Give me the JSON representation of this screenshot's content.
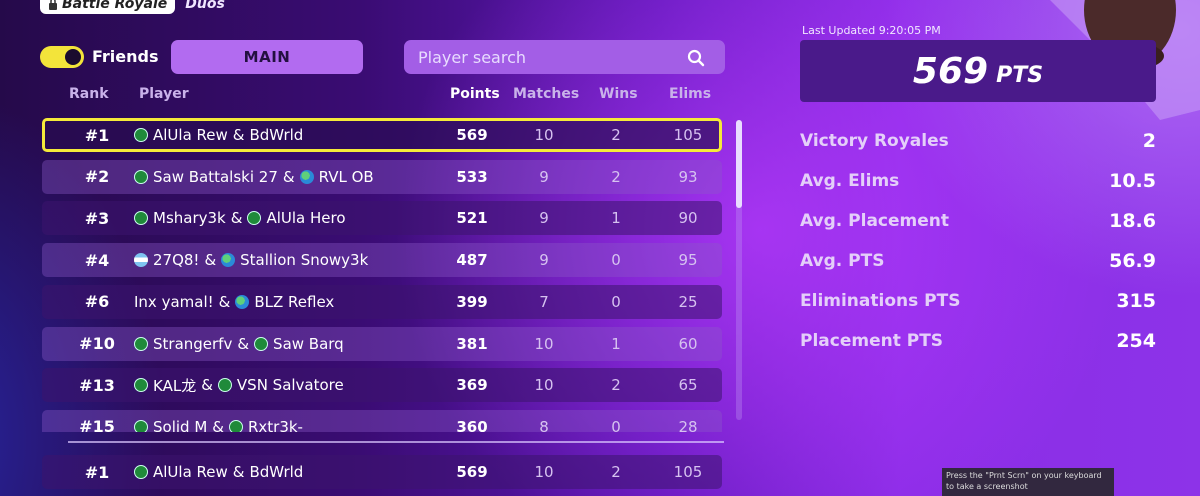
{
  "header": {
    "mode_label": "Battle Royale",
    "sub_mode": "Duos"
  },
  "controls": {
    "friends_label": "Friends",
    "friends_toggle_on": true,
    "main_label": "MAIN",
    "search_placeholder": "Player search"
  },
  "columns": {
    "rank": "Rank",
    "player": "Player",
    "points": "Points",
    "matches": "Matches",
    "wins": "Wins",
    "elims": "Elims"
  },
  "rows": [
    {
      "rank": "#1",
      "p1": "AlUla Rew",
      "sep": "&",
      "p2": "BdWrld",
      "points": "569",
      "matches": "10",
      "wins": "2",
      "elims": "105",
      "f1": "sa",
      "f2": "",
      "selected": true
    },
    {
      "rank": "#2",
      "p1": "Saw Battalski 27",
      "sep": "&",
      "p2": "RVL OB",
      "points": "533",
      "matches": "9",
      "wins": "2",
      "elims": "93",
      "f1": "sa",
      "f2": "globe"
    },
    {
      "rank": "#3",
      "p1": "Mshary3k",
      "sep": "&",
      "p2": "AlUla Hero",
      "points": "521",
      "matches": "9",
      "wins": "1",
      "elims": "90",
      "f1": "sa",
      "f2": "sa"
    },
    {
      "rank": "#4",
      "p1": "27Q8!",
      "sep": "&",
      "p2": "Stallion Snowy3k",
      "points": "487",
      "matches": "9",
      "wins": "0",
      "elims": "95",
      "f1": "ar",
      "f2": "globe"
    },
    {
      "rank": "#6",
      "p1": "Inx yamal!",
      "sep": "&",
      "p2": "BLZ Reflex",
      "points": "399",
      "matches": "7",
      "wins": "0",
      "elims": "25",
      "f1": "",
      "f2": "globe"
    },
    {
      "rank": "#10",
      "p1": "Strangerfv",
      "sep": "&",
      "p2": "Saw Barq",
      "points": "381",
      "matches": "10",
      "wins": "1",
      "elims": "60",
      "f1": "sa",
      "f2": "sa"
    },
    {
      "rank": "#13",
      "p1": "KAL龙",
      "sep": "&",
      "p2": "VSN Salvatore",
      "points": "369",
      "matches": "10",
      "wins": "2",
      "elims": "65",
      "f1": "sa",
      "f2": "sa"
    },
    {
      "rank": "#15",
      "p1": "Solid M",
      "sep": "&",
      "p2": "Rxtr3k-",
      "points": "360",
      "matches": "8",
      "wins": "0",
      "elims": "28",
      "f1": "sa",
      "f2": "sa"
    }
  ],
  "my_row": {
    "rank": "#1",
    "p1": "AlUla Rew",
    "sep": "&",
    "p2": "BdWrld",
    "points": "569",
    "matches": "10",
    "wins": "2",
    "elims": "105",
    "f1": "sa",
    "f2": ""
  },
  "summary": {
    "last_updated": "Last Updated 9:20:05 PM",
    "points_value": "569",
    "points_unit": "PTS",
    "stats": [
      {
        "label": "Victory Royales",
        "value": "2"
      },
      {
        "label": "Avg. Elims",
        "value": "10.5"
      },
      {
        "label": "Avg. Placement",
        "value": "18.6"
      },
      {
        "label": "Avg. PTS",
        "value": "56.9"
      },
      {
        "label": "Eliminations PTS",
        "value": "315"
      },
      {
        "label": "Placement PTS",
        "value": "254"
      }
    ]
  },
  "toast": "Press the \"Prnt Scrn\" on your keyboard to take a screenshot"
}
